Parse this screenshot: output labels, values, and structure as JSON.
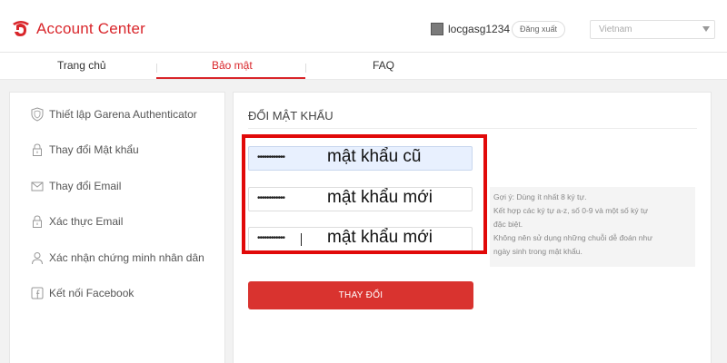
{
  "header": {
    "app_title": "Account Center",
    "username": "locgasg1234",
    "logout_label": "Đăng xuất",
    "country": "Vietnam"
  },
  "tabs": [
    {
      "label": "Trang chủ",
      "active": false
    },
    {
      "label": "Bảo mật",
      "active": true
    },
    {
      "label": "FAQ",
      "active": false
    }
  ],
  "sidebar": {
    "items": [
      {
        "label": "Thiết lập Garena Authenticator",
        "icon": "shield-icon"
      },
      {
        "label": "Thay đổi Mật khẩu",
        "icon": "lock-icon"
      },
      {
        "label": "Thay đổi Email",
        "icon": "envelope-icon"
      },
      {
        "label": "Xác thực Email",
        "icon": "lock-icon"
      },
      {
        "label": "Xác nhận chứng minh nhân dân",
        "icon": "person-icon"
      },
      {
        "label": "Kết nối Facebook",
        "icon": "facebook-icon"
      }
    ]
  },
  "main": {
    "section_title": "ĐỔI MẬT KHẨU",
    "fields": [
      {
        "masked_value": "••••••••••••",
        "overlay_label": "mật khẩu cũ"
      },
      {
        "masked_value": "••••••••••••",
        "overlay_label": "mật khẩu mới"
      },
      {
        "masked_value": "••••••••••••",
        "overlay_label": "mật khẩu mới"
      }
    ],
    "hint_lines": [
      "Gợi ý: Dùng ít nhất 8 ký tự.",
      "Kết hợp các ký tự a-z, số 0-9 và một số ký tự",
      "đặc biệt.",
      "Không nên sử dụng những chuỗi dễ đoán như",
      "ngày sinh trong mật khẩu."
    ],
    "submit_label": "THAY ĐỔI"
  },
  "colors": {
    "accent": "#d9262b",
    "highlight": "#e10909",
    "button": "#d9332f"
  }
}
